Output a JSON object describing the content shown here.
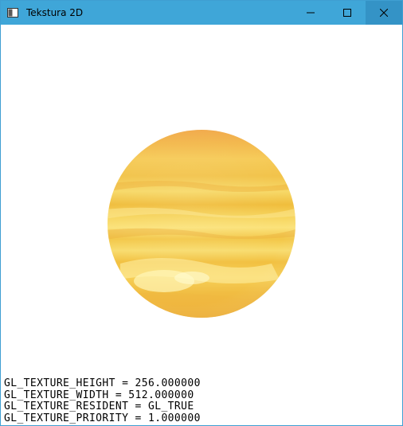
{
  "window": {
    "title": "Tekstura 2D",
    "app_icon": "window-app-icon",
    "controls": {
      "minimize_icon": "minimize-icon",
      "maximize_icon": "maximize-icon",
      "close_icon": "close-icon"
    },
    "colors": {
      "titlebar": "#3fa6d8",
      "close_hover": "#3493c6",
      "client": "#ffffff"
    }
  },
  "scene": {
    "object": "textured-sphere",
    "texture_colors": [
      "#f5d25a",
      "#eeb83a",
      "#fbe88a",
      "#f0a83c"
    ]
  },
  "info": {
    "lines": [
      "GL_TEXTURE_HEIGHT = 256.000000",
      "GL_TEXTURE_WIDTH = 512.000000",
      "GL_TEXTURE_RESIDENT = GL_TRUE",
      "GL_TEXTURE_PRIORITY = 1.000000"
    ]
  }
}
